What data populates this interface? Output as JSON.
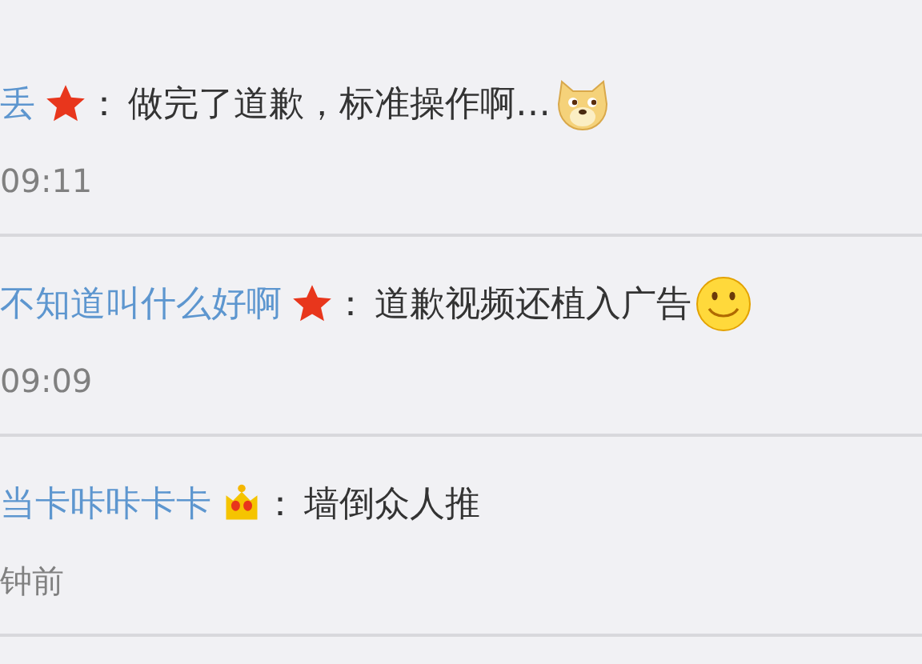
{
  "comments": [
    {
      "user": "丢",
      "badge": {
        "kind": "star"
      },
      "separator": "：",
      "text": "做完了道歉，标准操作啊…",
      "emoji": {
        "kind": "doge"
      },
      "time": "09:11"
    },
    {
      "user": "不知道叫什么好啊",
      "badge": {
        "kind": "star"
      },
      "separator": "：",
      "text": "道歉视频还植入广告",
      "emoji": {
        "kind": "smile"
      },
      "time": "09:09"
    },
    {
      "user": "当卡咔咔卡卡",
      "badge": {
        "kind": "crown"
      },
      "separator": "：",
      "text": "墙倒众人推",
      "time": "钟前"
    }
  ]
}
